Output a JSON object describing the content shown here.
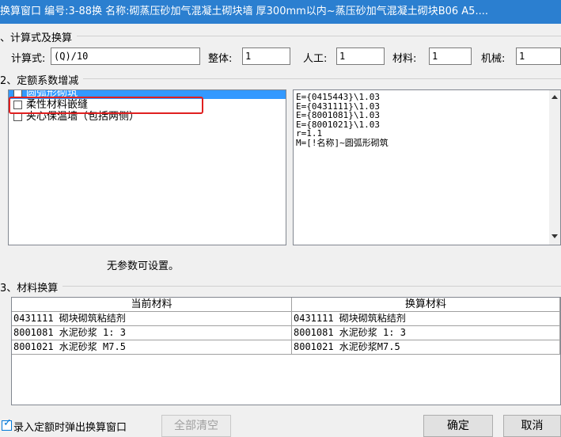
{
  "window": {
    "title": "换算窗口 编号:3-88换 名称:砌蒸压砂加气混凝土砌块墙 厚300mm以内~蒸压砂加气混凝土砌块B06 A5...."
  },
  "section1": {
    "label": "、计算式及换算",
    "calc_label": "计算式:",
    "calc_value": "(Q)/10",
    "whole_label": "整体:",
    "whole_value": "1",
    "labor_label": "人工:",
    "labor_value": "1",
    "material_label": "材料:",
    "material_value": "1",
    "machine_label": "机械:",
    "machine_value": "1"
  },
  "section2": {
    "label": "2、定额系数增减",
    "items": [
      {
        "label": "圆弧形砌筑",
        "checked": false,
        "selected": true
      },
      {
        "label": "柔性材料嵌缝",
        "checked": false,
        "selected": false
      },
      {
        "label": "夹心保温墙（包括两侧）",
        "checked": false,
        "selected": false
      }
    ],
    "formula_lines": [
      "E={0415443}\\1.03",
      "E={0431111}\\1.03",
      "E={8001081}\\1.03",
      "E={8001021}\\1.03",
      "r=1.1",
      "M=[!名称]~圆弧形砌筑"
    ],
    "no_param_text": "无参数可设置。"
  },
  "section3": {
    "label": "3、材料换算",
    "columns": [
      "当前材料",
      "换算材料"
    ],
    "rows": [
      [
        "0431111 砌块砌筑粘结剂",
        "0431111 砌块砌筑粘结剂"
      ],
      [
        "8001081 水泥砂浆 1: 3",
        "8001081 水泥砂浆 1: 3"
      ],
      [
        "8001021 水泥砂浆 M7.5",
        "8001021 水泥砂浆M7.5"
      ]
    ]
  },
  "footer": {
    "popup_checkbox_label": "录入定额时弹出换算窗口",
    "popup_checked": true,
    "clear_all_label": "全部清空",
    "ok_label": "确定",
    "cancel_label": "取消"
  }
}
